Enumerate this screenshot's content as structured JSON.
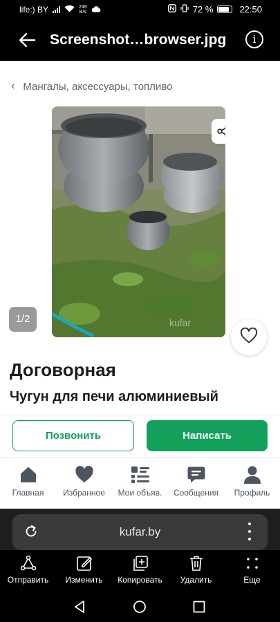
{
  "status_bar": {
    "carrier": "life:) BY",
    "net_speed_value": "249",
    "net_speed_unit": "B/s",
    "battery_percent": "72 %",
    "time": "22:50"
  },
  "viewer": {
    "title": "Screenshot…browser.jpg",
    "info_glyph": "i"
  },
  "listing": {
    "breadcrumb": "Мангалы, аксессуары, топливо",
    "photo_counter": "1/2",
    "watermark": "kufar",
    "price": "Договорная",
    "title": "Чугун для печи алюминиевый",
    "call_label": "Позвонить",
    "write_label": "Написать"
  },
  "tabs": [
    {
      "label": "Главная",
      "icon": "home-icon"
    },
    {
      "label": "Избранное",
      "icon": "heart-icon"
    },
    {
      "label": "Мои объяв.",
      "icon": "list-icon"
    },
    {
      "label": "Сообщения",
      "icon": "chat-icon"
    },
    {
      "label": "Профиль",
      "icon": "profile-icon"
    }
  ],
  "browser": {
    "url": "kufar.by"
  },
  "image_actions": [
    {
      "label": "Отправить",
      "icon": "share-icon"
    },
    {
      "label": "Изменить",
      "icon": "edit-icon"
    },
    {
      "label": "Копировать",
      "icon": "copy-icon"
    },
    {
      "label": "Удалить",
      "icon": "trash-icon"
    },
    {
      "label": "Еще",
      "icon": "more-icon"
    }
  ],
  "colors": {
    "accent": "#12a05a",
    "tab_icon": "#4d5660"
  }
}
